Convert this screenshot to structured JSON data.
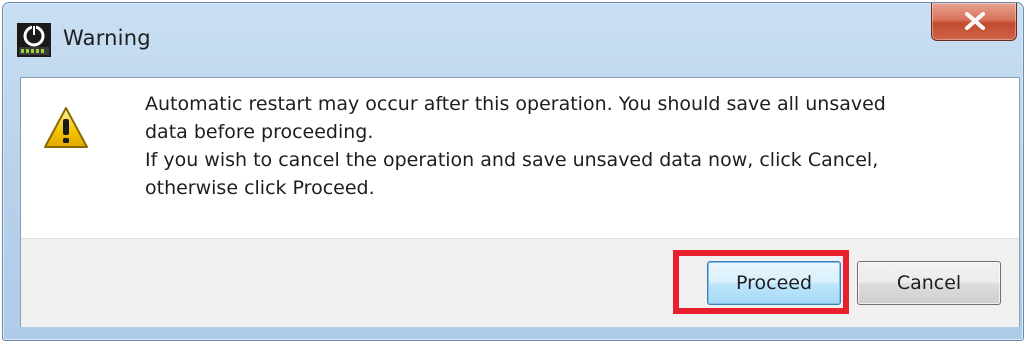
{
  "window": {
    "title": "Warning",
    "app_icon": "app-logo-icon",
    "close_glyph": "X",
    "close_icon": "close-icon"
  },
  "message": {
    "icon": "warning-triangle-icon",
    "lines": [
      "Automatic restart may occur after this operation. You should save all unsaved",
      "data before proceeding.",
      "If you wish to cancel the operation and save unsaved data now, click Cancel,",
      "otherwise click Proceed."
    ]
  },
  "buttons": {
    "proceed_label": "Proceed",
    "cancel_label": "Cancel"
  },
  "annotation": {
    "highlight_target": "proceed-button",
    "highlight_color": "#e8202e"
  },
  "colors": {
    "close_button": "#c24b2f",
    "warning_yellow": "#f5c400",
    "title_bar": "#bad3ec"
  }
}
